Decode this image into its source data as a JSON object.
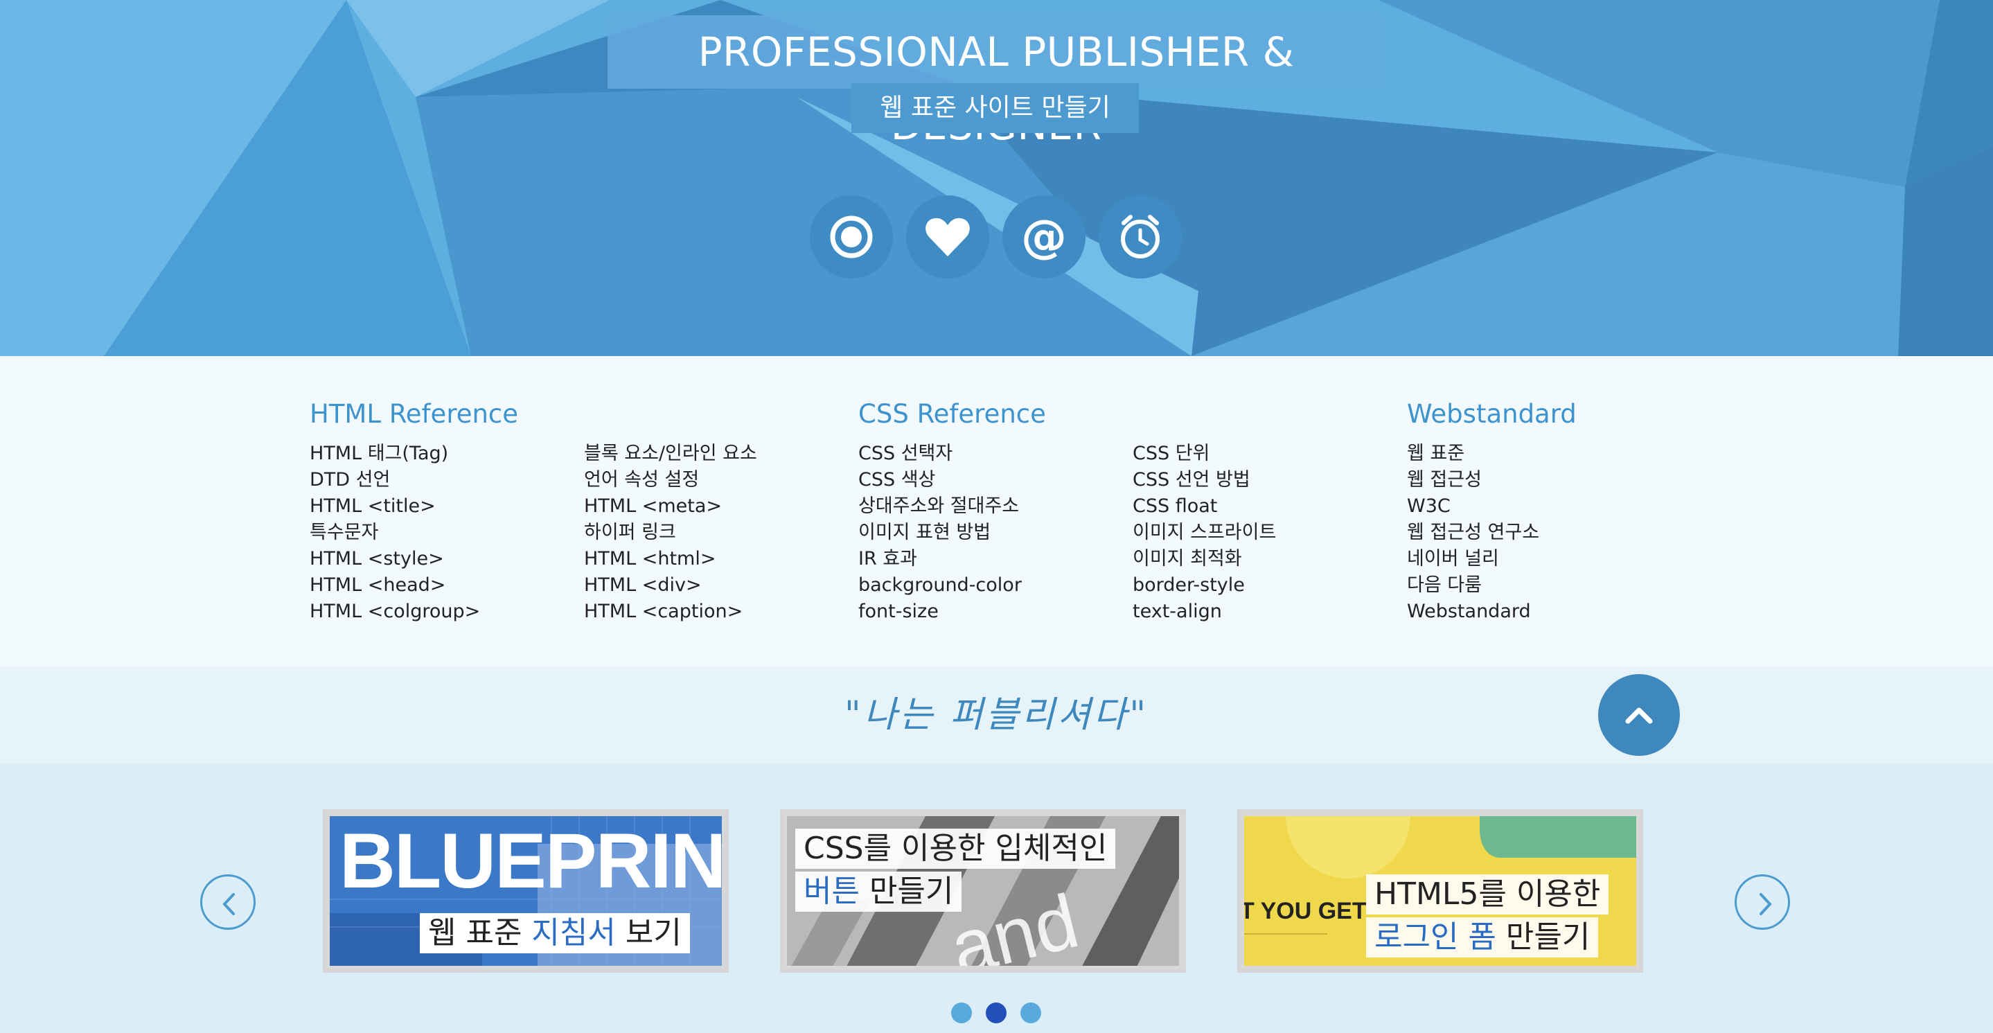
{
  "hero": {
    "title": "PROFESSIONAL PUBLISHER & DESIGNER",
    "subtitle": "웹 표준 사이트 만들기",
    "icons": [
      "radio-icon",
      "heart-icon",
      "at-icon",
      "alarm-icon"
    ]
  },
  "references": [
    {
      "title": "HTML Reference",
      "col1": [
        "HTML 태그(Tag)",
        "DTD 선언",
        "HTML <title>",
        "특수문자",
        "HTML <style>",
        "HTML <head>",
        "HTML <colgroup>"
      ],
      "col2": [
        "블록 요소/인라인 요소",
        "언어 속성 설정",
        "HTML <meta>",
        "하이퍼 링크",
        "HTML <html>",
        "HTML <div>",
        "HTML <caption>"
      ]
    },
    {
      "title": "CSS Reference",
      "col1": [
        "CSS 선택자",
        "CSS 색상",
        "상대주소와 절대주소",
        "이미지 표현 방법",
        "IR 효과",
        "background-color",
        "font-size"
      ],
      "col2": [
        "CSS 단위",
        "CSS 선언 방법",
        "CSS float",
        "이미지 스프라이트",
        "이미지 최적화",
        "border-style",
        "text-align"
      ]
    },
    {
      "title": "Webstandard",
      "col1": [
        "웹 표준",
        "웹 접근성",
        "W3C",
        "웹 접근성 연구소",
        "네이버 널리",
        "다음 다룸",
        "Webstandard"
      ]
    }
  ],
  "quote": "\"나는 퍼블리셔다\"",
  "slides": [
    {
      "image_text": "BLUEPRINTS",
      "caption_plain": "웹 표준 ",
      "caption_highlight": "지침서",
      "caption_tail": " 보기"
    },
    {
      "image_text": "and inte",
      "line1": "CSS를 이용한 입체적인",
      "line2_highlight": "버튼",
      "line2_tail": " 만들기"
    },
    {
      "image_text": "T YOU GET",
      "line1": "HTML5를 이용한",
      "line2_highlight": "로그인 폼",
      "line2_tail": " 만들기"
    }
  ],
  "slider": {
    "active_dot": 2,
    "dot_count": 3
  },
  "colors": {
    "accent": "#3f88bd",
    "hero": "#5aa9dd",
    "link_highlight": "#2a6cc4"
  }
}
